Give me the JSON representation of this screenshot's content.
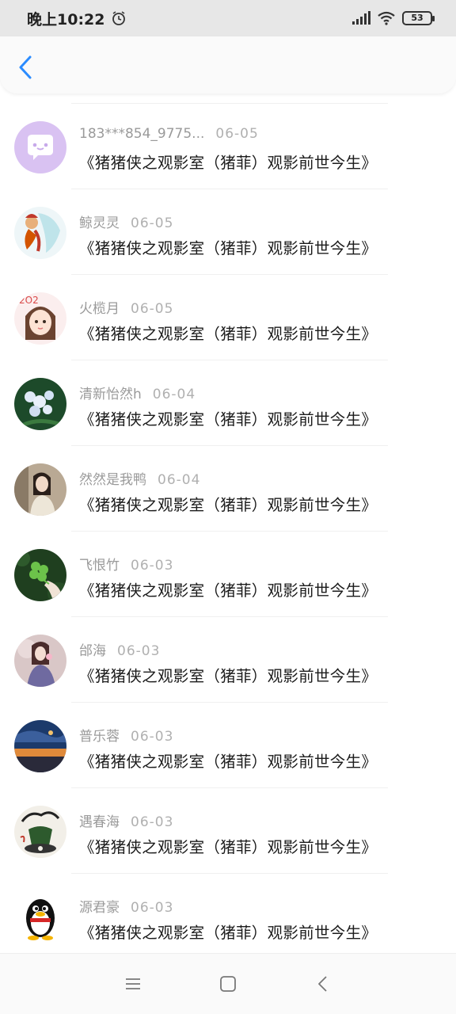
{
  "status_bar": {
    "time": "晚上10:22",
    "battery": "53"
  },
  "header": {
    "back_icon": "chevron-left-icon"
  },
  "comments": [
    {
      "user": "183***854_9775...",
      "date": "06-05",
      "title": "《猪猪侠之观影室（猪菲）观影前世今生》",
      "avatar": "chat-bubble-avatar"
    },
    {
      "user": "鲸灵灵",
      "date": "06-05",
      "title": "《猪猪侠之观影室（猪菲）观影前世今生》",
      "avatar": "anime-girl-avatar"
    },
    {
      "user": "火榄月",
      "date": "06-05",
      "title": "《猪猪侠之观影室（猪菲）观影前世今生》",
      "avatar": "cartoon-girl-avatar"
    },
    {
      "user": "清新怡然h",
      "date": "06-04",
      "title": "《猪猪侠之观影室（猪菲）观影前世今生》",
      "avatar": "flowers-avatar"
    },
    {
      "user": "然然是我鸭",
      "date": "06-04",
      "title": "《猪猪侠之观影室（猪菲）观影前世今生》",
      "avatar": "girl-photo-avatar"
    },
    {
      "user": "飞恨竹",
      "date": "06-03",
      "title": "《猪猪侠之观影室（猪菲）观影前世今生》",
      "avatar": "clover-avatar"
    },
    {
      "user": "邰海",
      "date": "06-03",
      "title": "《猪猪侠之观影室（猪菲）观影前世今生》",
      "avatar": "blurred-girl-avatar"
    },
    {
      "user": "普乐蓉",
      "date": "06-03",
      "title": "《猪猪侠之观影室（猪菲）观影前世今生》",
      "avatar": "sunset-sky-avatar"
    },
    {
      "user": "遇春海",
      "date": "06-03",
      "title": "《猪猪侠之观影室（猪菲）观影前世今生》",
      "avatar": "sketch-art-avatar"
    },
    {
      "user": "源君豪",
      "date": "06-03",
      "title": "《猪猪侠之观影室（猪菲）观影前世今生》",
      "avatar": "qq-penguin-avatar"
    }
  ],
  "nav": {
    "menu_icon": "menu-icon",
    "home_icon": "home-square-icon",
    "back_icon": "back-triangle-icon"
  },
  "colors": {
    "accent": "#2b8cff",
    "meta_text": "#9a9a9a",
    "title_text": "#1b1b1b"
  }
}
